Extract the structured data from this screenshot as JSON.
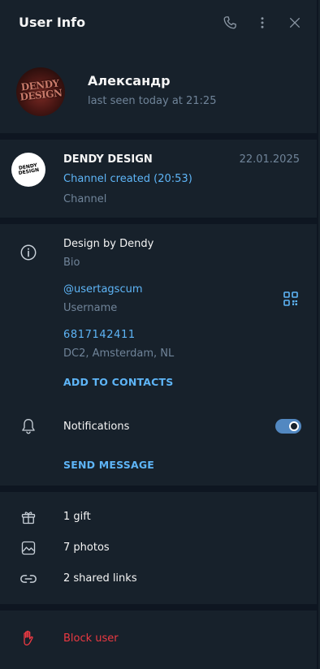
{
  "header": {
    "title": "User Info",
    "icons": [
      "phone-icon",
      "more-vertical-icon",
      "close-icon"
    ]
  },
  "profile": {
    "name": "Александр",
    "status": "last seen today at 21:25",
    "avatar_text": "DENDY DESIGN"
  },
  "channel": {
    "name": "DENDY DESIGN",
    "date": "22.01.2025",
    "last_message": "Channel created (20:53)",
    "type": "Channel",
    "avatar_text": "DENDY DESIGN"
  },
  "info": {
    "bio": {
      "value": "Design by Dendy",
      "label": "Bio"
    },
    "username": {
      "value": "@usertagscum",
      "label": "Username"
    },
    "phone": {
      "value": "6817142411",
      "label": "DC2, Amsterdam, NL"
    },
    "add_contact": "ADD TO CONTACTS",
    "notifications": {
      "label": "Notifications",
      "enabled": true
    },
    "send_message": "SEND MESSAGE"
  },
  "media": {
    "gifts": "1 gift",
    "photos": "7 photos",
    "links": "2 shared links"
  },
  "danger": {
    "block": "Block user"
  },
  "colors": {
    "background": "#17212b",
    "separator": "#0e1621",
    "accent": "#5eb5f7",
    "muted": "#708499",
    "danger": "#ec3942",
    "toggle": "#5288c1"
  }
}
